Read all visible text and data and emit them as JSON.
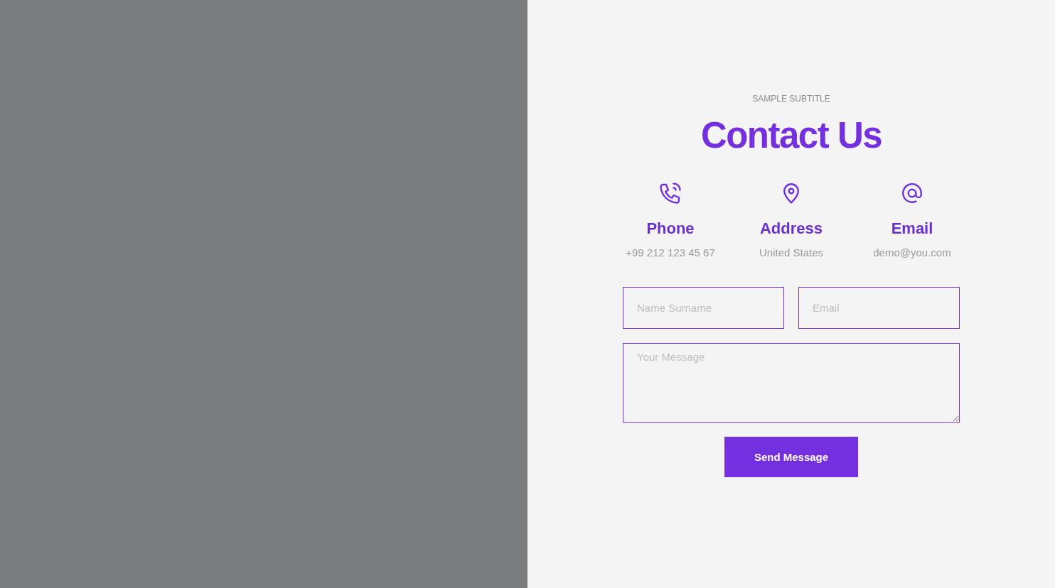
{
  "subtitle": "SAMPLE SUBTITLE",
  "title": "Contact Us",
  "contacts": [
    {
      "kind": "phone",
      "label": "Phone",
      "value": "+99 212 123 45 67"
    },
    {
      "kind": "address",
      "label": "Address",
      "value": "United States"
    },
    {
      "kind": "email",
      "label": "Email",
      "value": "demo@you.com"
    }
  ],
  "form": {
    "name_placeholder": "Name Surname",
    "email_placeholder": "Email",
    "message_placeholder": "Your Message",
    "submit": "Send Message"
  }
}
